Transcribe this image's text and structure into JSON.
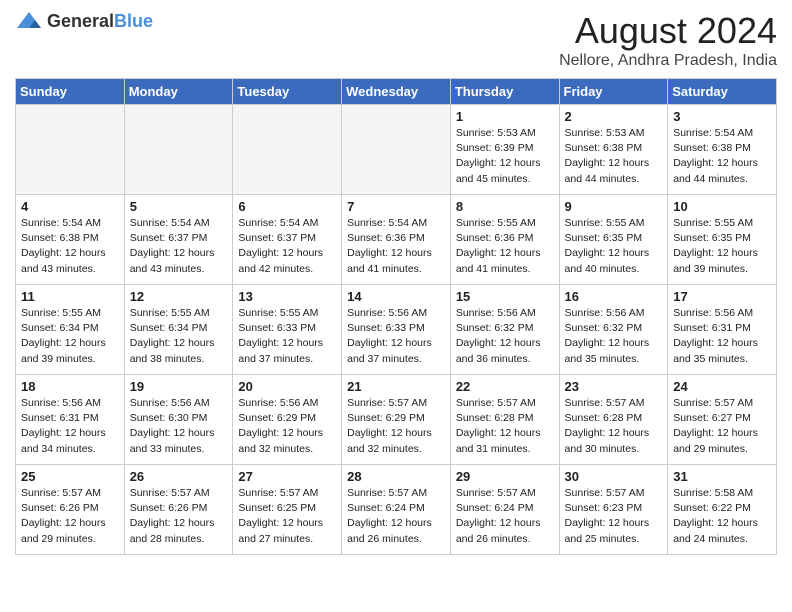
{
  "logo": {
    "general": "General",
    "blue": "Blue"
  },
  "title": {
    "month_year": "August 2024",
    "location": "Nellore, Andhra Pradesh, India"
  },
  "headers": [
    "Sunday",
    "Monday",
    "Tuesday",
    "Wednesday",
    "Thursday",
    "Friday",
    "Saturday"
  ],
  "weeks": [
    [
      {
        "day": "",
        "info": "",
        "empty": true
      },
      {
        "day": "",
        "info": "",
        "empty": true
      },
      {
        "day": "",
        "info": "",
        "empty": true
      },
      {
        "day": "",
        "info": "",
        "empty": true
      },
      {
        "day": "1",
        "info": "Sunrise: 5:53 AM\nSunset: 6:39 PM\nDaylight: 12 hours\nand 45 minutes."
      },
      {
        "day": "2",
        "info": "Sunrise: 5:53 AM\nSunset: 6:38 PM\nDaylight: 12 hours\nand 44 minutes."
      },
      {
        "day": "3",
        "info": "Sunrise: 5:54 AM\nSunset: 6:38 PM\nDaylight: 12 hours\nand 44 minutes."
      }
    ],
    [
      {
        "day": "4",
        "info": "Sunrise: 5:54 AM\nSunset: 6:38 PM\nDaylight: 12 hours\nand 43 minutes."
      },
      {
        "day": "5",
        "info": "Sunrise: 5:54 AM\nSunset: 6:37 PM\nDaylight: 12 hours\nand 43 minutes."
      },
      {
        "day": "6",
        "info": "Sunrise: 5:54 AM\nSunset: 6:37 PM\nDaylight: 12 hours\nand 42 minutes."
      },
      {
        "day": "7",
        "info": "Sunrise: 5:54 AM\nSunset: 6:36 PM\nDaylight: 12 hours\nand 41 minutes."
      },
      {
        "day": "8",
        "info": "Sunrise: 5:55 AM\nSunset: 6:36 PM\nDaylight: 12 hours\nand 41 minutes."
      },
      {
        "day": "9",
        "info": "Sunrise: 5:55 AM\nSunset: 6:35 PM\nDaylight: 12 hours\nand 40 minutes."
      },
      {
        "day": "10",
        "info": "Sunrise: 5:55 AM\nSunset: 6:35 PM\nDaylight: 12 hours\nand 39 minutes."
      }
    ],
    [
      {
        "day": "11",
        "info": "Sunrise: 5:55 AM\nSunset: 6:34 PM\nDaylight: 12 hours\nand 39 minutes."
      },
      {
        "day": "12",
        "info": "Sunrise: 5:55 AM\nSunset: 6:34 PM\nDaylight: 12 hours\nand 38 minutes."
      },
      {
        "day": "13",
        "info": "Sunrise: 5:55 AM\nSunset: 6:33 PM\nDaylight: 12 hours\nand 37 minutes."
      },
      {
        "day": "14",
        "info": "Sunrise: 5:56 AM\nSunset: 6:33 PM\nDaylight: 12 hours\nand 37 minutes."
      },
      {
        "day": "15",
        "info": "Sunrise: 5:56 AM\nSunset: 6:32 PM\nDaylight: 12 hours\nand 36 minutes."
      },
      {
        "day": "16",
        "info": "Sunrise: 5:56 AM\nSunset: 6:32 PM\nDaylight: 12 hours\nand 35 minutes."
      },
      {
        "day": "17",
        "info": "Sunrise: 5:56 AM\nSunset: 6:31 PM\nDaylight: 12 hours\nand 35 minutes."
      }
    ],
    [
      {
        "day": "18",
        "info": "Sunrise: 5:56 AM\nSunset: 6:31 PM\nDaylight: 12 hours\nand 34 minutes."
      },
      {
        "day": "19",
        "info": "Sunrise: 5:56 AM\nSunset: 6:30 PM\nDaylight: 12 hours\nand 33 minutes."
      },
      {
        "day": "20",
        "info": "Sunrise: 5:56 AM\nSunset: 6:29 PM\nDaylight: 12 hours\nand 32 minutes."
      },
      {
        "day": "21",
        "info": "Sunrise: 5:57 AM\nSunset: 6:29 PM\nDaylight: 12 hours\nand 32 minutes."
      },
      {
        "day": "22",
        "info": "Sunrise: 5:57 AM\nSunset: 6:28 PM\nDaylight: 12 hours\nand 31 minutes."
      },
      {
        "day": "23",
        "info": "Sunrise: 5:57 AM\nSunset: 6:28 PM\nDaylight: 12 hours\nand 30 minutes."
      },
      {
        "day": "24",
        "info": "Sunrise: 5:57 AM\nSunset: 6:27 PM\nDaylight: 12 hours\nand 29 minutes."
      }
    ],
    [
      {
        "day": "25",
        "info": "Sunrise: 5:57 AM\nSunset: 6:26 PM\nDaylight: 12 hours\nand 29 minutes."
      },
      {
        "day": "26",
        "info": "Sunrise: 5:57 AM\nSunset: 6:26 PM\nDaylight: 12 hours\nand 28 minutes."
      },
      {
        "day": "27",
        "info": "Sunrise: 5:57 AM\nSunset: 6:25 PM\nDaylight: 12 hours\nand 27 minutes."
      },
      {
        "day": "28",
        "info": "Sunrise: 5:57 AM\nSunset: 6:24 PM\nDaylight: 12 hours\nand 26 minutes."
      },
      {
        "day": "29",
        "info": "Sunrise: 5:57 AM\nSunset: 6:24 PM\nDaylight: 12 hours\nand 26 minutes."
      },
      {
        "day": "30",
        "info": "Sunrise: 5:57 AM\nSunset: 6:23 PM\nDaylight: 12 hours\nand 25 minutes."
      },
      {
        "day": "31",
        "info": "Sunrise: 5:58 AM\nSunset: 6:22 PM\nDaylight: 12 hours\nand 24 minutes."
      }
    ]
  ]
}
